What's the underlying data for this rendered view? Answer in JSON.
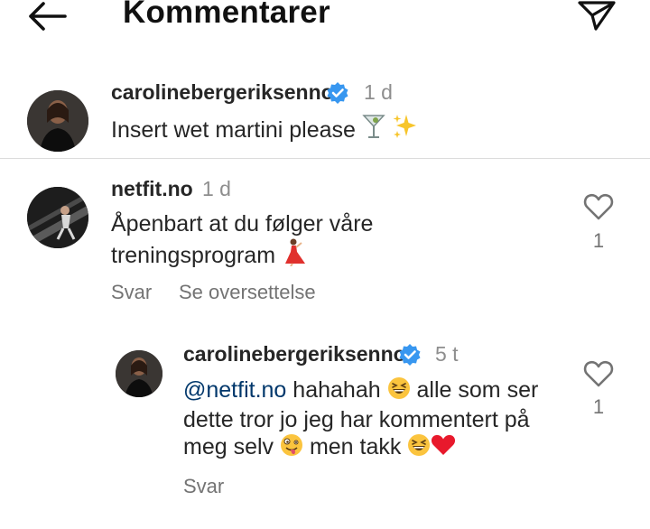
{
  "header": {
    "title": "Kommentarer",
    "back_icon": "arrow-left-icon",
    "send_icon": "paper-plane-icon"
  },
  "caption": {
    "username": "carolinebergeriksenno",
    "verified": true,
    "time": "1 d",
    "text": "Insert wet martini please",
    "emojis": [
      "martini-glass-icon",
      "sparkles-icon"
    ]
  },
  "comment": {
    "username": "netfit.no",
    "time": "1 d",
    "text_line1": "Åpenbart at du følger våre",
    "text_line2": "treningsprogram",
    "emoji": "dancer-icon",
    "likes": "1",
    "reply_label": "Svar",
    "translate_label": "Se oversettelse"
  },
  "reply": {
    "username": "carolinebergeriksenno",
    "verified": true,
    "time": "5 t",
    "mention": "@netfit.no",
    "line1_text": "hahahah",
    "line1_tail": "alle som ser",
    "line2": "dette tror jo jeg har kommentert på",
    "line3_head": "meg selv",
    "line3_mid": "men takk",
    "likes": "1",
    "reply_label": "Svar"
  },
  "colors": {
    "verified_blue": "#3897f0",
    "mention_blue": "#00376b",
    "muted": "#8e8e8e",
    "heart_red": "#e0245e"
  }
}
